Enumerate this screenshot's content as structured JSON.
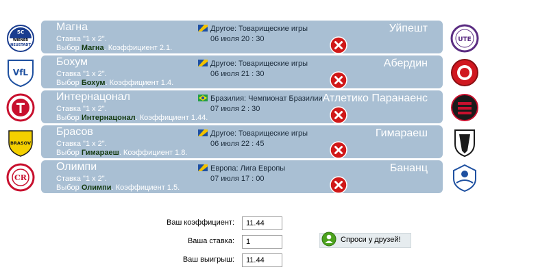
{
  "colors": {
    "row_background": "#a9bfd3",
    "team_choice_text": "#143a10",
    "remove_button": "#d01818",
    "ask_button_background": "#e6ecef",
    "ask_icon": "#4ca21e"
  },
  "bets": [
    {
      "home_team": "Магна",
      "bet_type": "Ставка \"1 x 2\".",
      "choice_prefix": "Выбор ",
      "choice_team": "Магна",
      "odds_text": ". Коэффициент 2.1.",
      "flag_icon": "europe-flag-icon",
      "tournament": "Другое: Товарищеские игры",
      "date": "06 июля 20 : 30",
      "away_team": "Уйпешт",
      "home_logo": "magna-logo",
      "away_logo": "ujpest-logo"
    },
    {
      "home_team": "Бохум",
      "bet_type": "Ставка \"1 x 2\".",
      "choice_prefix": "Выбор ",
      "choice_team": "Бохум",
      "odds_text": ". Коэффициент 1.4.",
      "flag_icon": "europe-flag-icon",
      "tournament": "Другое: Товарищеские игры",
      "date": "06 июля 21 : 30",
      "away_team": "Абердин",
      "home_logo": "bochum-logo",
      "away_logo": "aberdeen-logo"
    },
    {
      "home_team": "Интернацонал",
      "bet_type": "Ставка \"1 x 2\".",
      "choice_prefix": "Выбор ",
      "choice_team": "Интернацонал",
      "odds_text": ". Коэффициент 1.44.",
      "flag_icon": "brazil-flag-icon",
      "tournament": "Бразилия: Чемпионат Бразилии",
      "date": "07 июля 2 : 30",
      "away_team": "Атлетико Паранаенс",
      "home_logo": "internacional-logo",
      "away_logo": "atletico-paranaense-logo"
    },
    {
      "home_team": "Брасов",
      "bet_type": "Ставка \"1 x 2\".",
      "choice_prefix": "Выбор ",
      "choice_team": "Гимараеш",
      "odds_text": ". Коэффициент 1.8.",
      "flag_icon": "europe-flag-icon",
      "tournament": "Другое: Товарищеские игры",
      "date": "06 июля 22 : 45",
      "away_team": "Гимараеш",
      "home_logo": "brasov-logo",
      "away_logo": "guimaraes-logo"
    },
    {
      "home_team": "Олимпи",
      "bet_type": "Ставка \"1 x 2\".",
      "choice_prefix": "Выбор ",
      "choice_team": "Олимпи",
      "odds_text": ". Коэффициент 1.5.",
      "flag_icon": "europe-flag-icon",
      "tournament": "Европа: Лига Европы",
      "date": "07 июля 17 : 00",
      "away_team": "Бананц",
      "home_logo": "olimpi-logo",
      "away_logo": "banants-logo"
    }
  ],
  "calculator": {
    "odds_label": "Ваш коэффициент:",
    "odds_value": "11.44",
    "stake_label": "Ваша ставка:",
    "stake_value": "1",
    "winnings_label": "Ваш выигрыш:",
    "winnings_value": "11.44"
  },
  "ask_friends": {
    "label": "Спроси у друзей!",
    "icon": "person-icon"
  },
  "logo_text": {
    "magna_line1": "SC",
    "magna_line2": "WIENER",
    "magna_line3": "NEUSTADT",
    "bochum": "VfL",
    "ujpest": "UTE",
    "brasov": "BRASOV",
    "olimpi": "CR"
  }
}
